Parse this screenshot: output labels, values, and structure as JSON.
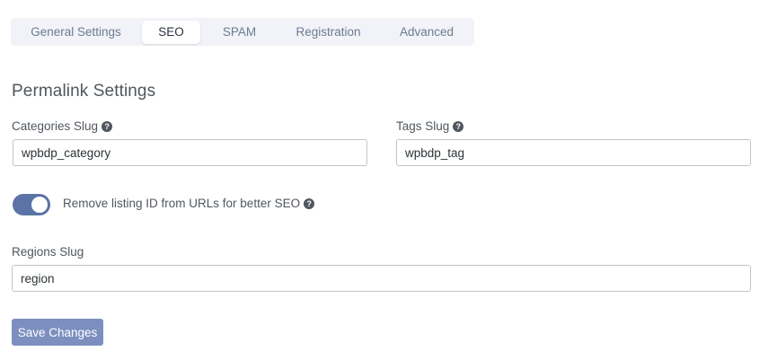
{
  "tabs": [
    {
      "label": "General Settings",
      "active": false
    },
    {
      "label": "SEO",
      "active": true
    },
    {
      "label": "SPAM",
      "active": false
    },
    {
      "label": "Registration",
      "active": false
    },
    {
      "label": "Advanced",
      "active": false
    }
  ],
  "section": {
    "heading": "Permalink Settings"
  },
  "fields": {
    "categories": {
      "label": "Categories Slug",
      "value": "wpbdp_category",
      "help_icon": "question-circle-icon"
    },
    "tags": {
      "label": "Tags Slug",
      "value": "wpbdp_tag",
      "help_icon": "question-circle-icon"
    },
    "regions": {
      "label": "Regions Slug",
      "value": "region"
    }
  },
  "toggle": {
    "label": "Remove listing ID from URLs for better SEO",
    "state": "on",
    "help_icon": "question-circle-icon"
  },
  "save_button": {
    "label": "Save Changes"
  },
  "colors": {
    "accent": "#5b73a6",
    "button": "#7c8fbf",
    "tab_bar": "#f1f3f8"
  }
}
